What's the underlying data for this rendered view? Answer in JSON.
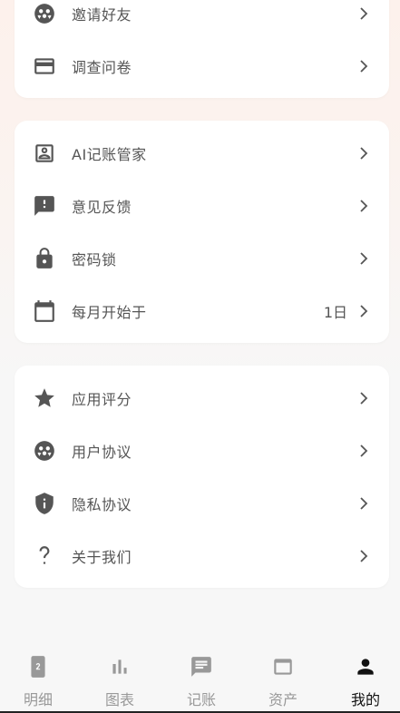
{
  "group1": {
    "items": [
      {
        "label": "邀请好友",
        "icon": "invite-icon"
      },
      {
        "label": "调查问卷",
        "icon": "card-icon"
      }
    ]
  },
  "group2": {
    "items": [
      {
        "label": "AI记账管家",
        "icon": "contact-icon"
      },
      {
        "label": "意见反馈",
        "icon": "feedback-icon"
      },
      {
        "label": "密码锁",
        "icon": "lock-icon"
      },
      {
        "label": "每月开始于",
        "value": "1日",
        "icon": "calendar-icon"
      }
    ]
  },
  "group3": {
    "items": [
      {
        "label": "应用评分",
        "icon": "star-icon"
      },
      {
        "label": "用户协议",
        "icon": "user-agreement-icon"
      },
      {
        "label": "隐私协议",
        "icon": "shield-icon"
      },
      {
        "label": "关于我们",
        "icon": "question-icon"
      }
    ]
  },
  "tabbar": {
    "tabs": [
      {
        "label": "明细",
        "icon": "detail-icon"
      },
      {
        "label": "图表",
        "icon": "chart-icon"
      },
      {
        "label": "记账",
        "icon": "message-icon"
      },
      {
        "label": "资产",
        "icon": "wallet-icon"
      },
      {
        "label": "我的",
        "icon": "person-icon",
        "active": true
      }
    ]
  },
  "colors": {
    "icon": "#555555",
    "tab_inactive": "#999999",
    "tab_active": "#111111"
  }
}
